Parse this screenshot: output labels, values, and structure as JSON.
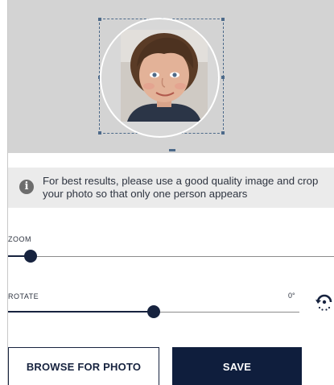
{
  "info": {
    "icon": "info-icon",
    "text": "For best results, please use a good quality image and crop your photo so that only one person appears"
  },
  "zoom": {
    "label": "ZOOM",
    "level": 0.07
  },
  "rotate": {
    "label": "ROTATE",
    "value": "0°",
    "level": 0.5,
    "reset_icon": "rotate-icon"
  },
  "buttons": {
    "browse_label": "BROWSE FOR PHOTO",
    "save_label": "SAVE"
  },
  "colors": {
    "primary": "#0f1e3d",
    "crop_background": "#d3d3d3",
    "banner_background": "#ebebeb"
  }
}
